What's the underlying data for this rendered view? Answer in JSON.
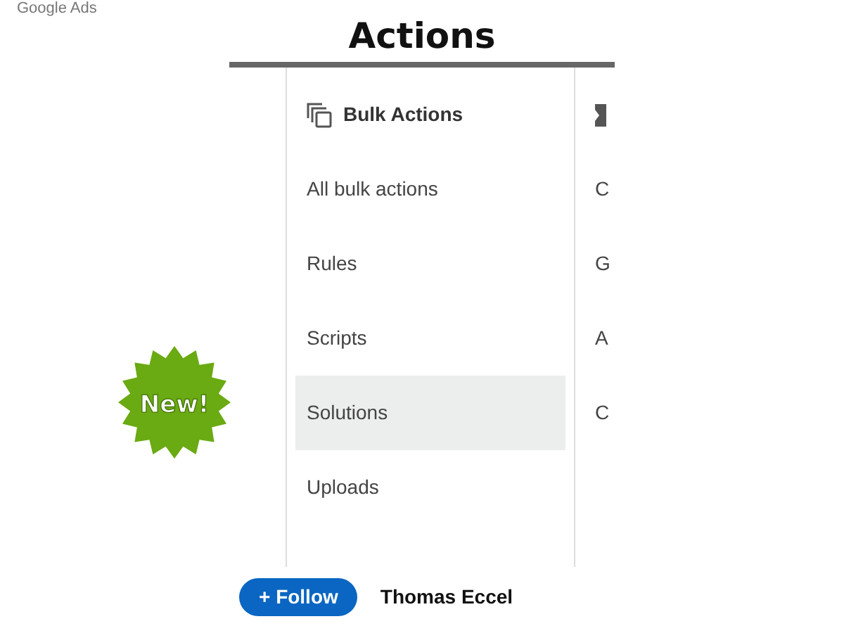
{
  "logo": "Google Ads",
  "title": "Actions",
  "badge": "New!",
  "menu": {
    "header": "Bulk Actions",
    "items": [
      {
        "label": "All bulk actions",
        "selected": false
      },
      {
        "label": "Rules",
        "selected": false
      },
      {
        "label": "Scripts",
        "selected": false
      },
      {
        "label": "Solutions",
        "selected": true
      },
      {
        "label": "Uploads",
        "selected": false
      }
    ]
  },
  "next_column": {
    "items": [
      "C",
      "G",
      "A",
      "C"
    ]
  },
  "footer": {
    "follow_button": "+ Follow",
    "author": "Thomas Eccel"
  }
}
